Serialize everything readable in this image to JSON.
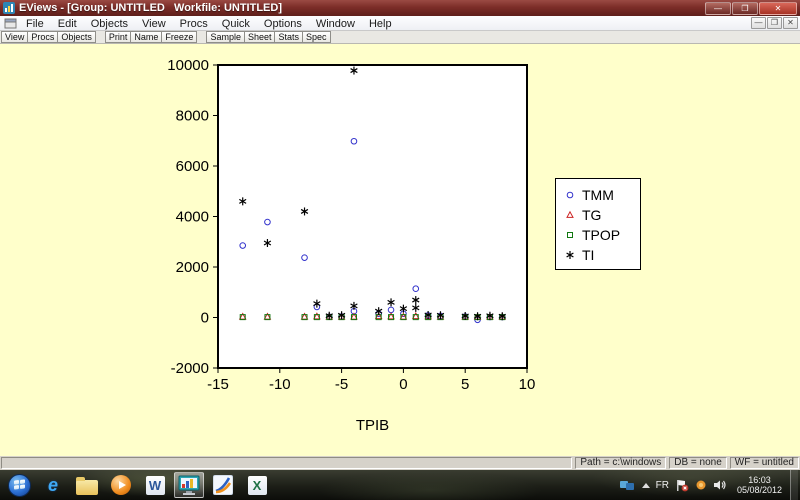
{
  "window": {
    "title": "EViews - [Group: UNTITLED   Workfile: UNTITLED]",
    "controls": {
      "minimize": "—",
      "restore": "❐",
      "close": "✕"
    }
  },
  "child_window": {
    "controls": {
      "minimize": "—",
      "restore": "❐",
      "close": "✕"
    }
  },
  "menu_bar": {
    "items": [
      "File",
      "Edit",
      "Objects",
      "View",
      "Procs",
      "Quick",
      "Options",
      "Window",
      "Help"
    ]
  },
  "toolbar": {
    "groups": [
      [
        "View",
        "Procs",
        "Objects"
      ],
      [
        "Print",
        "Name",
        "Freeze"
      ],
      [
        "Sample",
        "Sheet",
        "Stats",
        "Spec"
      ]
    ]
  },
  "chart_data": {
    "type": "scatter",
    "title": "",
    "xlabel": "TPIB",
    "ylabel": "",
    "xlim": [
      -15,
      10
    ],
    "ylim": [
      -2000,
      10000
    ],
    "x_ticks": [
      -15,
      -10,
      -5,
      0,
      5,
      10
    ],
    "y_ticks": [
      -2000,
      0,
      2000,
      4000,
      6000,
      8000,
      10000
    ],
    "grid": false,
    "legend_position": "right-outside",
    "series": [
      {
        "name": "TMM",
        "marker": "circle",
        "color": "#3333cc",
        "points": [
          [
            -13,
            2850
          ],
          [
            -11,
            3780
          ],
          [
            -8,
            2370
          ],
          [
            -7,
            420
          ],
          [
            -6,
            30
          ],
          [
            -5,
            40
          ],
          [
            -4,
            6980
          ],
          [
            -4,
            250
          ],
          [
            -2,
            150
          ],
          [
            -1,
            300
          ],
          [
            0,
            150
          ],
          [
            1,
            1140
          ],
          [
            2,
            80
          ],
          [
            3,
            60
          ],
          [
            5,
            40
          ],
          [
            6,
            -90
          ],
          [
            7,
            20
          ],
          [
            8,
            20
          ]
        ]
      },
      {
        "name": "TG",
        "marker": "triangle",
        "color": "#cc2222",
        "points": [
          [
            -13,
            30
          ],
          [
            -11,
            30
          ],
          [
            -8,
            30
          ],
          [
            -7,
            40
          ],
          [
            -6,
            30
          ],
          [
            -5,
            30
          ],
          [
            -4,
            30
          ],
          [
            -2,
            50
          ],
          [
            -1,
            40
          ],
          [
            0,
            30
          ],
          [
            1,
            50
          ],
          [
            2,
            40
          ],
          [
            3,
            30
          ],
          [
            5,
            30
          ],
          [
            6,
            30
          ],
          [
            7,
            30
          ],
          [
            8,
            30
          ]
        ]
      },
      {
        "name": "TPOP",
        "marker": "square",
        "color": "#117711",
        "points": [
          [
            -13,
            15
          ],
          [
            -11,
            15
          ],
          [
            -8,
            15
          ],
          [
            -7,
            15
          ],
          [
            -6,
            15
          ],
          [
            -5,
            15
          ],
          [
            -4,
            15
          ],
          [
            -2,
            15
          ],
          [
            -1,
            15
          ],
          [
            0,
            15
          ],
          [
            1,
            15
          ],
          [
            2,
            15
          ],
          [
            3,
            15
          ],
          [
            5,
            15
          ],
          [
            6,
            15
          ],
          [
            7,
            15
          ],
          [
            8,
            15
          ]
        ]
      },
      {
        "name": "TI",
        "marker": "asterisk",
        "color": "#000000",
        "points": [
          [
            -13,
            4600
          ],
          [
            -11,
            2950
          ],
          [
            -8,
            4200
          ],
          [
            -7,
            550
          ],
          [
            -6,
            70
          ],
          [
            -5,
            90
          ],
          [
            -4,
            9780
          ],
          [
            -4,
            460
          ],
          [
            -2,
            250
          ],
          [
            -1,
            600
          ],
          [
            0,
            350
          ],
          [
            1,
            690
          ],
          [
            1,
            380
          ],
          [
            2,
            100
          ],
          [
            3,
            90
          ],
          [
            5,
            60
          ],
          [
            6,
            50
          ],
          [
            7,
            70
          ],
          [
            8,
            50
          ]
        ]
      }
    ]
  },
  "status_bar": {
    "panels": [
      "Path = c:\\windows",
      "DB = none",
      "WF = untitled"
    ]
  },
  "taskbar": {
    "icons": [
      {
        "name": "start-button",
        "type": "start",
        "active": false
      },
      {
        "name": "internet-explorer-icon",
        "type": "ie",
        "glyph": "e",
        "active": false
      },
      {
        "name": "file-explorer-icon",
        "type": "folder",
        "active": false
      },
      {
        "name": "media-player-icon",
        "type": "media",
        "active": false
      },
      {
        "name": "word-icon",
        "type": "letter",
        "glyph": "W",
        "glyph_color": "#2b579a",
        "active": false
      },
      {
        "name": "eviews-icon",
        "type": "eviews",
        "active": true
      },
      {
        "name": "eviews7-icon",
        "type": "swoosh",
        "active": false
      },
      {
        "name": "excel-icon",
        "type": "letter",
        "glyph": "X",
        "glyph_color": "#1e7145",
        "active": false
      }
    ],
    "tray": {
      "language": "FR",
      "time": "16:03",
      "date": "05/08/2012"
    }
  },
  "colors": {
    "content_bg": "#ffffcb",
    "titlebar": "#7c2d28",
    "plot_bg": "#ffffff",
    "axis": "#000000"
  }
}
